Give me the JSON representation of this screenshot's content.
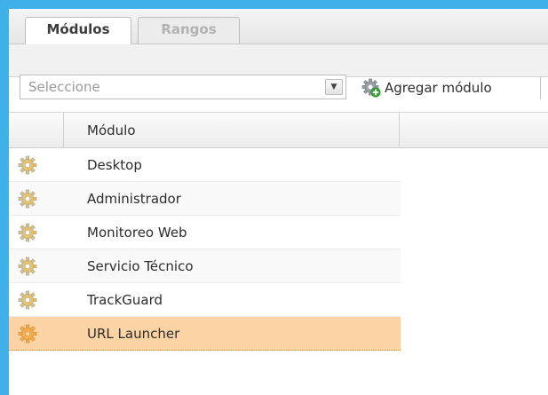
{
  "tabs": [
    {
      "label": "Módulos",
      "active": true
    },
    {
      "label": "Rangos",
      "active": false
    }
  ],
  "toolbar": {
    "select_placeholder": "Seleccione",
    "add_button_label": "Agregar módulo"
  },
  "grid": {
    "columns": [
      "",
      "Módulo"
    ],
    "rows": [
      {
        "label": "Desktop",
        "icon": "gear-icon",
        "selected": false
      },
      {
        "label": "Administrador",
        "icon": "gear-icon",
        "selected": false
      },
      {
        "label": "Monitoreo Web",
        "icon": "gear-icon",
        "selected": false
      },
      {
        "label": "Servicio Técnico",
        "icon": "gear-icon",
        "selected": false
      },
      {
        "label": "TrackGuard",
        "icon": "gear-icon",
        "selected": false
      },
      {
        "label": "URL Launcher",
        "icon": "gear-icon",
        "selected": true
      }
    ]
  },
  "colors": {
    "frame_border": "#3fb0e8",
    "selected_row": "#fbd3a4",
    "inactive_tab_text": "#b2b2b2"
  }
}
